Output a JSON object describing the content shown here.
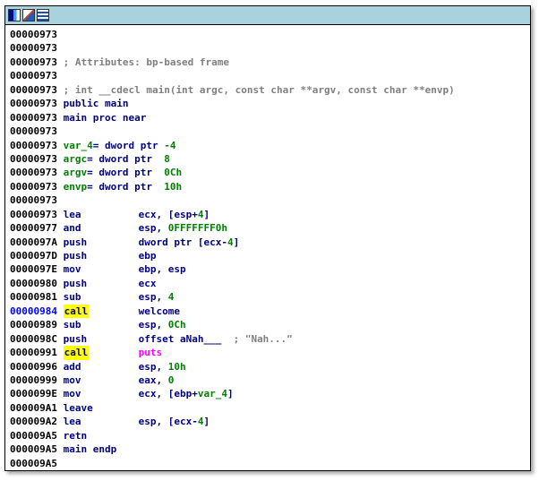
{
  "window": {
    "toolbar_icons": [
      "graph-view-icon",
      "edit-icon",
      "hex-view-icon"
    ]
  },
  "lines": [
    {
      "addr": "00000973",
      "parts": []
    },
    {
      "addr": "00000973",
      "parts": []
    },
    {
      "addr": "00000973",
      "parts": [
        {
          "c": "comment",
          "t": "; Attributes: bp-based frame"
        }
      ]
    },
    {
      "addr": "00000973",
      "parts": []
    },
    {
      "addr": "00000973",
      "parts": [
        {
          "c": "comment",
          "t": "; int __cdecl main(int argc, const char **argv, const char **envp)"
        }
      ]
    },
    {
      "addr": "00000973",
      "parts": [
        {
          "c": "lbl",
          "t": "public main"
        }
      ]
    },
    {
      "addr": "00000973",
      "parts": [
        {
          "c": "lbl",
          "t": "main proc near"
        }
      ]
    },
    {
      "addr": "00000973",
      "parts": []
    },
    {
      "addr": "00000973",
      "parts": [
        {
          "c": "var",
          "t": "var_4"
        },
        {
          "c": "ops",
          "t": "= dword ptr "
        },
        {
          "c": "num",
          "t": "-4"
        }
      ]
    },
    {
      "addr": "00000973",
      "parts": [
        {
          "c": "var",
          "t": "argc"
        },
        {
          "c": "ops",
          "t": "= dword ptr  "
        },
        {
          "c": "num",
          "t": "8"
        }
      ]
    },
    {
      "addr": "00000973",
      "parts": [
        {
          "c": "var",
          "t": "argv"
        },
        {
          "c": "ops",
          "t": "= dword ptr  "
        },
        {
          "c": "num",
          "t": "0Ch"
        }
      ]
    },
    {
      "addr": "00000973",
      "parts": [
        {
          "c": "var",
          "t": "envp"
        },
        {
          "c": "ops",
          "t": "= dword ptr  "
        },
        {
          "c": "num",
          "t": "10h"
        }
      ]
    },
    {
      "addr": "00000973",
      "parts": []
    },
    {
      "addr": "00000973",
      "mnem": "lea",
      "parts": [
        {
          "c": "ops",
          "t": "ecx, [esp+"
        },
        {
          "c": "num",
          "t": "4"
        },
        {
          "c": "ops",
          "t": "]"
        }
      ]
    },
    {
      "addr": "00000977",
      "mnem": "and",
      "parts": [
        {
          "c": "ops",
          "t": "esp, "
        },
        {
          "c": "num",
          "t": "0FFFFFFF0h"
        }
      ]
    },
    {
      "addr": "0000097A",
      "mnem": "push",
      "parts": [
        {
          "c": "ops",
          "t": "dword ptr [ecx-"
        },
        {
          "c": "num",
          "t": "4"
        },
        {
          "c": "ops",
          "t": "]"
        }
      ]
    },
    {
      "addr": "0000097D",
      "mnem": "push",
      "parts": [
        {
          "c": "ops",
          "t": "ebp"
        }
      ]
    },
    {
      "addr": "0000097E",
      "mnem": "mov",
      "parts": [
        {
          "c": "ops",
          "t": "ebp, esp"
        }
      ]
    },
    {
      "addr": "00000980",
      "mnem": "push",
      "parts": [
        {
          "c": "ops",
          "t": "ecx"
        }
      ]
    },
    {
      "addr": "00000981",
      "mnem": "sub",
      "parts": [
        {
          "c": "ops",
          "t": "esp, "
        },
        {
          "c": "num",
          "t": "4"
        }
      ]
    },
    {
      "addr": "00000984",
      "addr_hl": true,
      "mnem": "call",
      "mnem_hl": true,
      "parts": [
        {
          "c": "ops",
          "t": "welcome"
        }
      ]
    },
    {
      "addr": "00000989",
      "mnem": "sub",
      "parts": [
        {
          "c": "ops",
          "t": "esp, "
        },
        {
          "c": "num",
          "t": "0Ch"
        }
      ]
    },
    {
      "addr": "0000098C",
      "mnem": "push",
      "parts": [
        {
          "c": "ops",
          "t": "offset aNah___"
        },
        {
          "c": "str",
          "t": "  ; \"Nah...\""
        }
      ]
    },
    {
      "addr": "00000991",
      "mnem": "call",
      "mnem_hl": true,
      "parts": [
        {
          "c": "fn",
          "t": "puts"
        }
      ]
    },
    {
      "addr": "00000996",
      "mnem": "add",
      "parts": [
        {
          "c": "ops",
          "t": "esp, "
        },
        {
          "c": "num",
          "t": "10h"
        }
      ]
    },
    {
      "addr": "00000999",
      "mnem": "mov",
      "parts": [
        {
          "c": "ops",
          "t": "eax, "
        },
        {
          "c": "num",
          "t": "0"
        }
      ]
    },
    {
      "addr": "0000099E",
      "mnem": "mov",
      "parts": [
        {
          "c": "ops",
          "t": "ecx, [ebp+"
        },
        {
          "c": "var",
          "t": "var_4"
        },
        {
          "c": "ops",
          "t": "]"
        }
      ]
    },
    {
      "addr": "000009A1",
      "mnem": "leave",
      "parts": []
    },
    {
      "addr": "000009A2",
      "mnem": "lea",
      "parts": [
        {
          "c": "ops",
          "t": "esp, [ecx-"
        },
        {
          "c": "num",
          "t": "4"
        },
        {
          "c": "ops",
          "t": "]"
        }
      ]
    },
    {
      "addr": "000009A5",
      "mnem": "retn",
      "parts": []
    },
    {
      "addr": "000009A5",
      "parts": [
        {
          "c": "lbl",
          "t": "main endp"
        }
      ]
    },
    {
      "addr": "000009A5",
      "parts": []
    }
  ]
}
